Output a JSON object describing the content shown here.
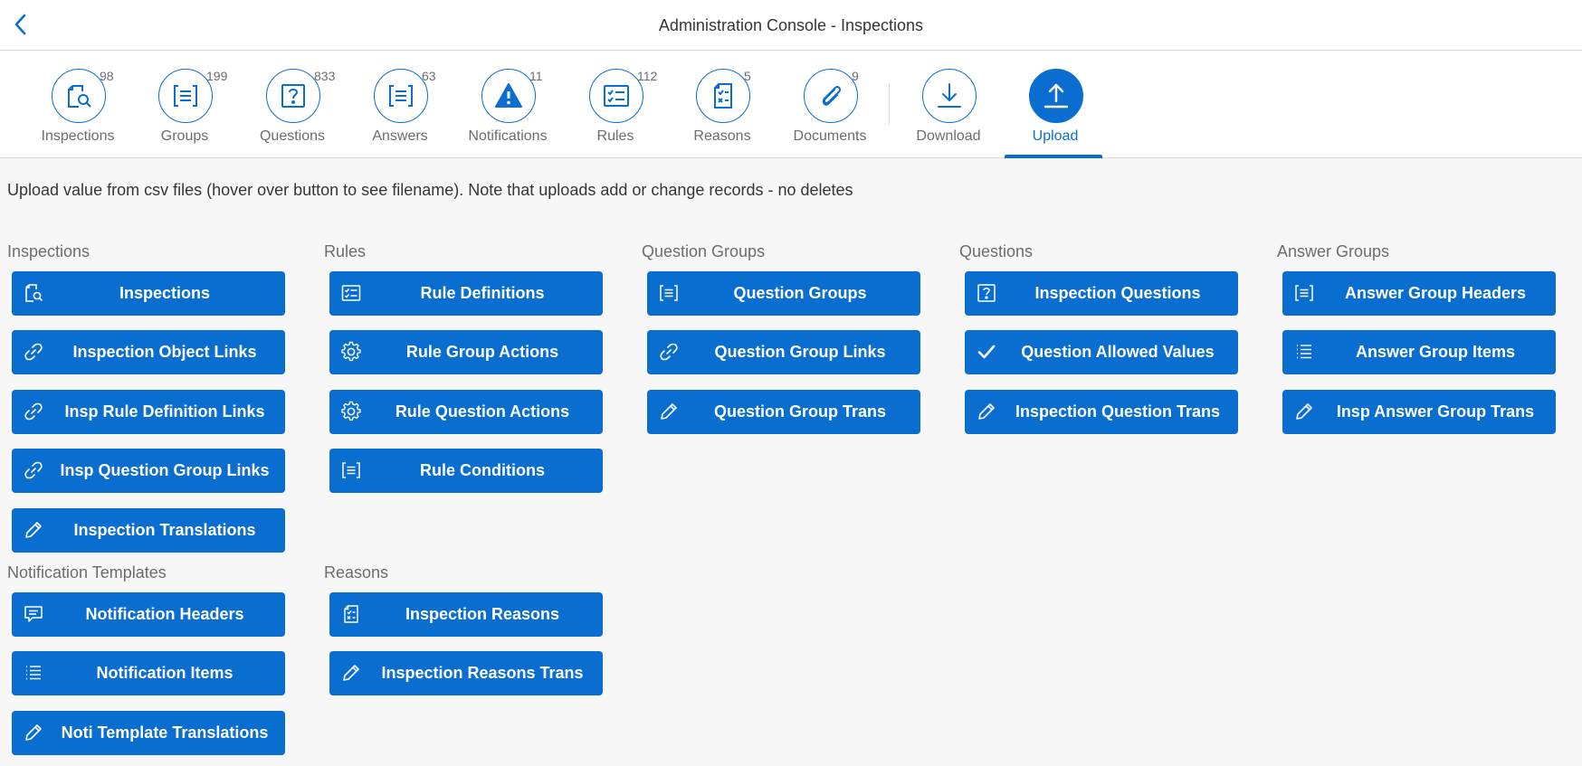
{
  "header": {
    "title": "Administration Console - Inspections"
  },
  "tabs": [
    {
      "label": "Inspections",
      "count": "98",
      "icon": "inspection-search-icon"
    },
    {
      "label": "Groups",
      "count": "199",
      "icon": "list-box-icon"
    },
    {
      "label": "Questions",
      "count": "833",
      "icon": "question-box-icon"
    },
    {
      "label": "Answers",
      "count": "63",
      "icon": "list-box-icon"
    },
    {
      "label": "Notifications",
      "count": "11",
      "icon": "warning-icon"
    },
    {
      "label": "Rules",
      "count": "112",
      "icon": "checklist-icon"
    },
    {
      "label": "Reasons",
      "count": "5",
      "icon": "document-checklist-icon"
    },
    {
      "label": "Documents",
      "count": "9",
      "icon": "paperclip-icon"
    },
    {
      "label": "Download",
      "count": "",
      "icon": "download-icon"
    },
    {
      "label": "Upload",
      "count": "",
      "icon": "upload-icon",
      "active": true
    }
  ],
  "intro": "Upload value from csv files (hover over button to see filename). Note that uploads add or change records - no deletes",
  "sections": {
    "inspections": {
      "title": "Inspections",
      "buttons": [
        {
          "label": "Inspections",
          "icon": "inspection-search-icon"
        },
        {
          "label": "Inspection Object Links",
          "icon": "link-icon"
        },
        {
          "label": "Insp Rule Definition Links",
          "icon": "link-icon"
        },
        {
          "label": "Insp Question Group Links",
          "icon": "link-icon"
        },
        {
          "label": "Inspection Translations",
          "icon": "pencil-icon"
        }
      ]
    },
    "rules": {
      "title": "Rules",
      "buttons": [
        {
          "label": "Rule Definitions",
          "icon": "checklist-icon"
        },
        {
          "label": "Rule Group Actions",
          "icon": "gear-icon"
        },
        {
          "label": "Rule Question Actions",
          "icon": "gear-icon"
        },
        {
          "label": "Rule Conditions",
          "icon": "list-box-icon"
        }
      ]
    },
    "question_groups": {
      "title": "Question Groups",
      "buttons": [
        {
          "label": "Question Groups",
          "icon": "list-box-icon"
        },
        {
          "label": "Question Group Links",
          "icon": "link-icon"
        },
        {
          "label": "Question Group Trans",
          "icon": "pencil-icon"
        }
      ]
    },
    "questions": {
      "title": "Questions",
      "buttons": [
        {
          "label": "Inspection Questions",
          "icon": "question-box-icon"
        },
        {
          "label": "Question Allowed Values",
          "icon": "checkmark-icon"
        },
        {
          "label": "Inspection Question Trans",
          "icon": "pencil-icon"
        }
      ]
    },
    "answer_groups": {
      "title": "Answer Groups",
      "buttons": [
        {
          "label": "Answer Group Headers",
          "icon": "list-box-icon"
        },
        {
          "label": "Answer Group Items",
          "icon": "bullet-list-icon"
        },
        {
          "label": "Insp Answer Group Trans",
          "icon": "pencil-icon"
        }
      ]
    },
    "notification_templates": {
      "title": "Notification Templates",
      "buttons": [
        {
          "label": "Notification Headers",
          "icon": "comment-icon"
        },
        {
          "label": "Notification Items",
          "icon": "bullet-list-icon"
        },
        {
          "label": "Noti Template Translations",
          "icon": "pencil-icon"
        }
      ]
    },
    "reasons": {
      "title": "Reasons",
      "buttons": [
        {
          "label": "Inspection Reasons",
          "icon": "document-checklist-icon"
        },
        {
          "label": "Inspection Reasons Trans",
          "icon": "pencil-icon"
        }
      ]
    }
  },
  "colors": {
    "accent": "#0a6ed1",
    "background": "#f7f7f7",
    "text": "#32363a",
    "muted": "#6a6d70"
  }
}
